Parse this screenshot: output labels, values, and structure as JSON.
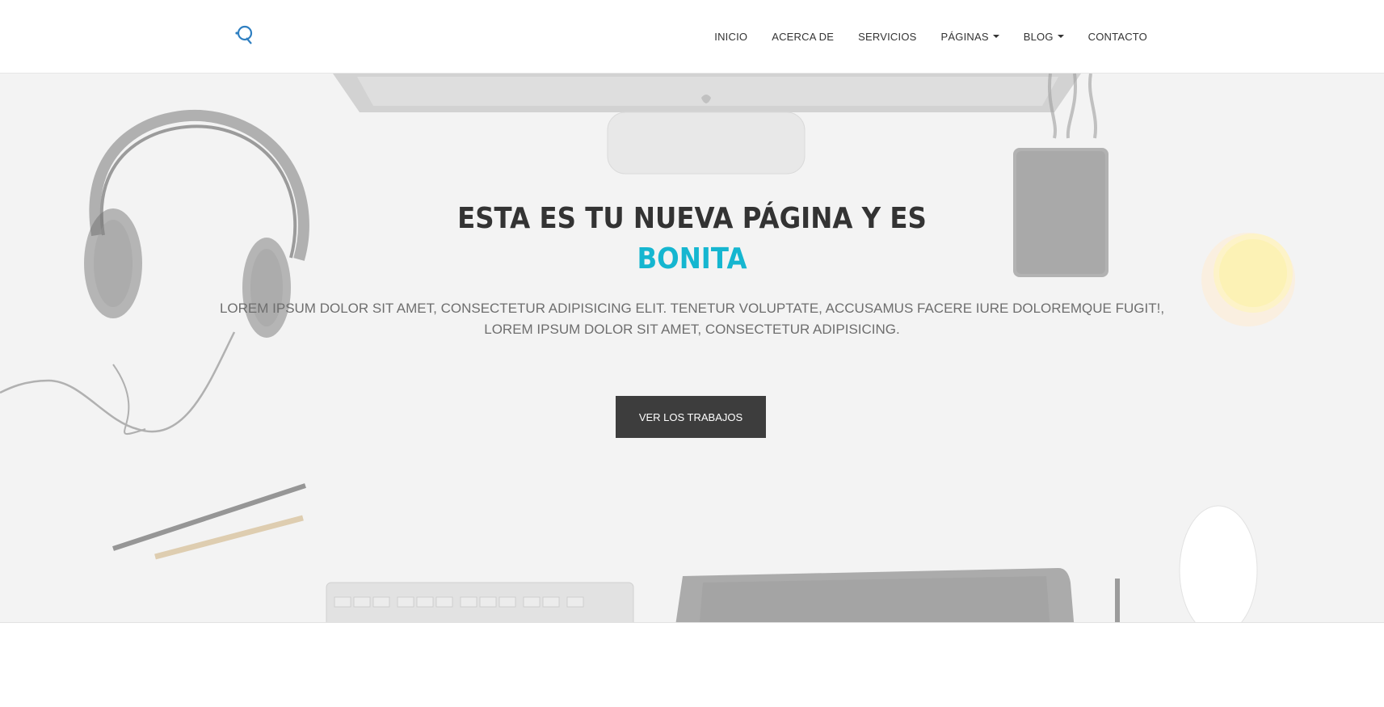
{
  "header": {
    "logo_icon": "q-logo-icon",
    "nav": [
      {
        "label": "INICIO",
        "dropdown": false
      },
      {
        "label": "ACERCA DE",
        "dropdown": false
      },
      {
        "label": "SERVICIOS",
        "dropdown": false
      },
      {
        "label": "PÁGINAS",
        "dropdown": true
      },
      {
        "label": "BLOG",
        "dropdown": true
      },
      {
        "label": "CONTACTO",
        "dropdown": false
      }
    ]
  },
  "hero": {
    "title_line1": "ESTA ES TU NUEVA PÁGINA Y ES",
    "title_accent": "BONITA",
    "subtitle_line1": "LOREM IPSUM DOLOR SIT AMET, CONSECTETUR ADIPISICING ELIT. TENETUR VOLUPTATE, ACCUSAMUS FACERE IURE DOLOREMQUE FUGIT!,",
    "subtitle_line2": "LOREM IPSUM DOLOR SIT AMET, CONSECTETUR ADIPISICING.",
    "button_label": "VER LOS TRABAJOS"
  },
  "colors": {
    "accent": "#15b6d0",
    "title": "#333333",
    "button_bg": "#3d3d3d",
    "hero_bg": "#f3f3f3"
  }
}
